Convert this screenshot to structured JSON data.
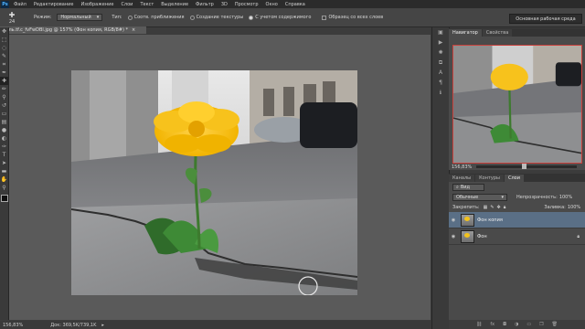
{
  "menu": [
    "Файл",
    "Редактирование",
    "Изображение",
    "Слои",
    "Текст",
    "Выделение",
    "Фильтр",
    "3D",
    "Просмотр",
    "Окно",
    "Справка"
  ],
  "app_logo": "Ps",
  "options": {
    "brush_size": "24",
    "mode_label": "Режим:",
    "mode_value": "Нормальный",
    "type_label": "Тип:",
    "radio1": "Соотв. приближения",
    "radio2": "Создание текстуры",
    "radio3": "С учетом содержимого",
    "checkbox": "Образец со всех слоев"
  },
  "workspace": "Основная рабочая среда",
  "document_tab": "цель.tf.c_fvFwDBl.jpg @ 157% (Фон копия, RGB/8#) *",
  "status": {
    "zoom": "156,83%",
    "doc": "Док: 369,5K/739,1K"
  },
  "navigator": {
    "tabs": [
      "Навигатор",
      "Свойства"
    ],
    "zoom": "156,83%"
  },
  "layers_panel": {
    "tabs": [
      "Каналы",
      "Контуры",
      "Слои"
    ],
    "kind": "Вид",
    "blend": "Обычные",
    "opacity_label": "Непрозрачность:",
    "opacity_value": "100%",
    "lock_label": "Закрепить:",
    "fill_label": "Заливка:",
    "fill_value": "100%",
    "layers": [
      {
        "name": "Фон копия",
        "selected": true
      },
      {
        "name": "Фон",
        "selected": false
      }
    ]
  },
  "colors": {
    "accent": "#c9413c",
    "selected_layer": "#5a6f86"
  }
}
